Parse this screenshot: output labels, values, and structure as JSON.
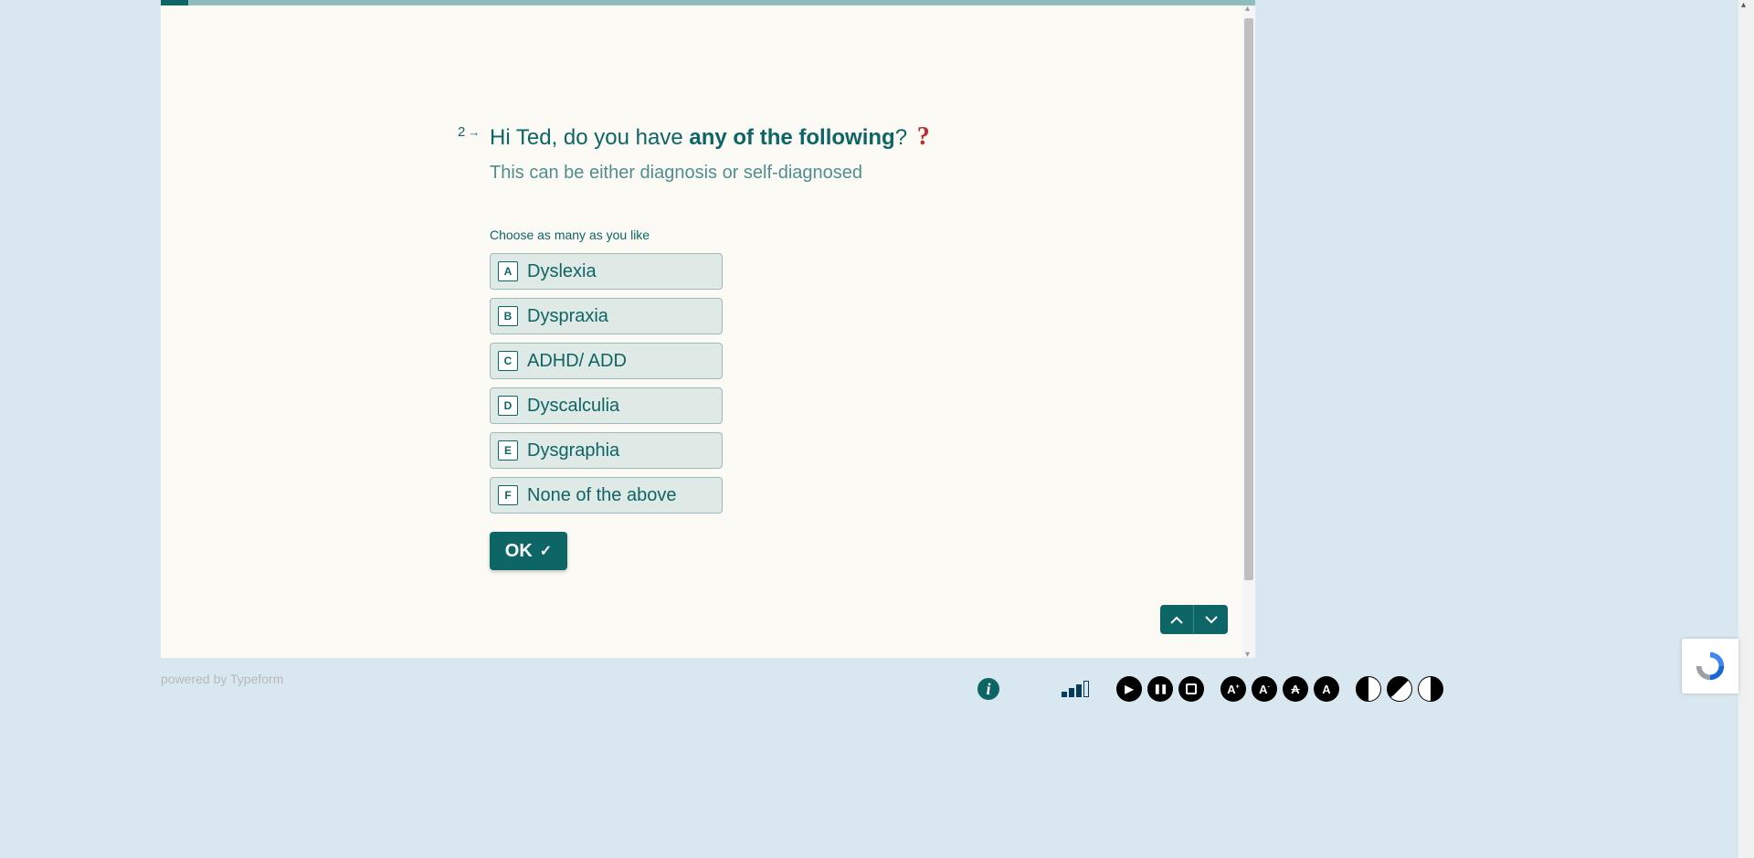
{
  "question": {
    "number": "2",
    "title_prefix": "Hi Ted, do you have ",
    "title_bold": "any of the following",
    "title_suffix": "?",
    "subtitle": "This can be either diagnosis or self-diagnosed",
    "instruction": "Choose as many as you like"
  },
  "options": [
    {
      "key": "A",
      "label": "Dyslexia"
    },
    {
      "key": "B",
      "label": "Dyspraxia"
    },
    {
      "key": "C",
      "label": "ADHD/ ADD"
    },
    {
      "key": "D",
      "label": "Dyscalculia"
    },
    {
      "key": "E",
      "label": "Dysgraphia"
    },
    {
      "key": "F",
      "label": "None of the above"
    }
  ],
  "ok_label": "OK",
  "footer": "powered by Typeform",
  "toolbar": {
    "info": "i",
    "play": "▶",
    "pause": "❚❚",
    "a_plus": "A",
    "a_minus": "A",
    "a_strike": "A",
    "a_plain": "A"
  }
}
